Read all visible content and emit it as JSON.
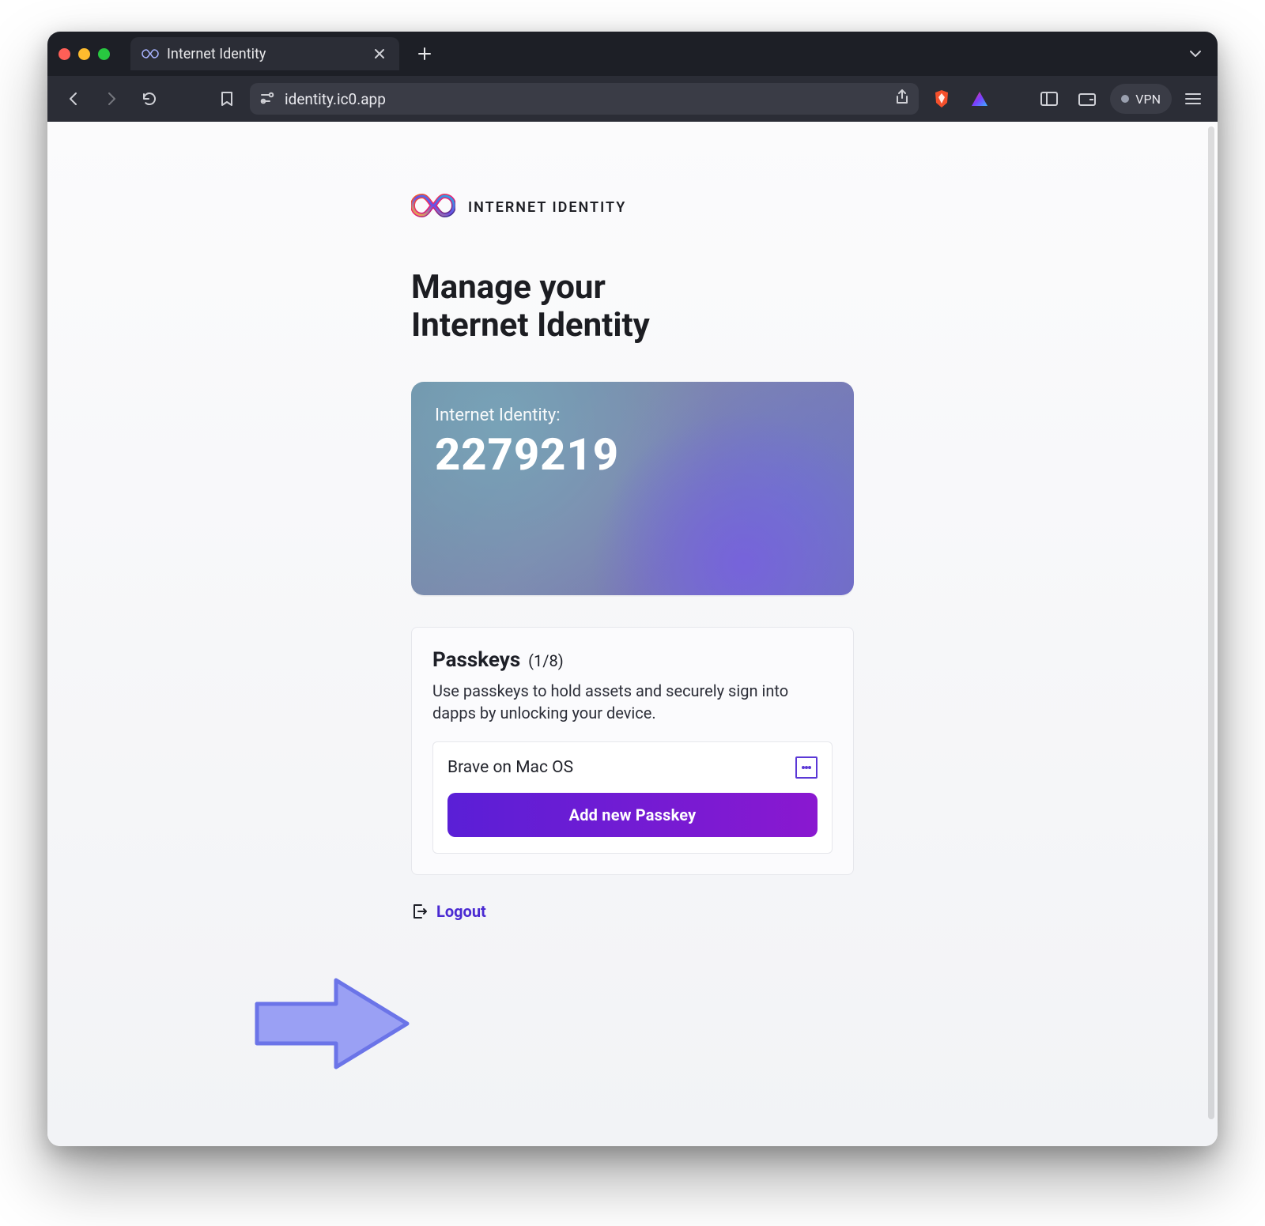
{
  "browser": {
    "tabTitle": "Internet Identity",
    "url": "identity.ic0.app",
    "vpnLabel": "VPN"
  },
  "page": {
    "brand": "INTERNET IDENTITY",
    "headingLine1": "Manage your",
    "headingLine2": "Internet Identity",
    "idcard": {
      "label": "Internet Identity:",
      "number": "2279219"
    },
    "passkeys": {
      "title": "Passkeys",
      "count": "(1/8)",
      "description": "Use passkeys to hold assets and securely sign into dapps by unlocking your device.",
      "items": [
        {
          "name": "Brave on Mac OS"
        }
      ],
      "addLabel": "Add new Passkey"
    },
    "logout": "Logout"
  }
}
